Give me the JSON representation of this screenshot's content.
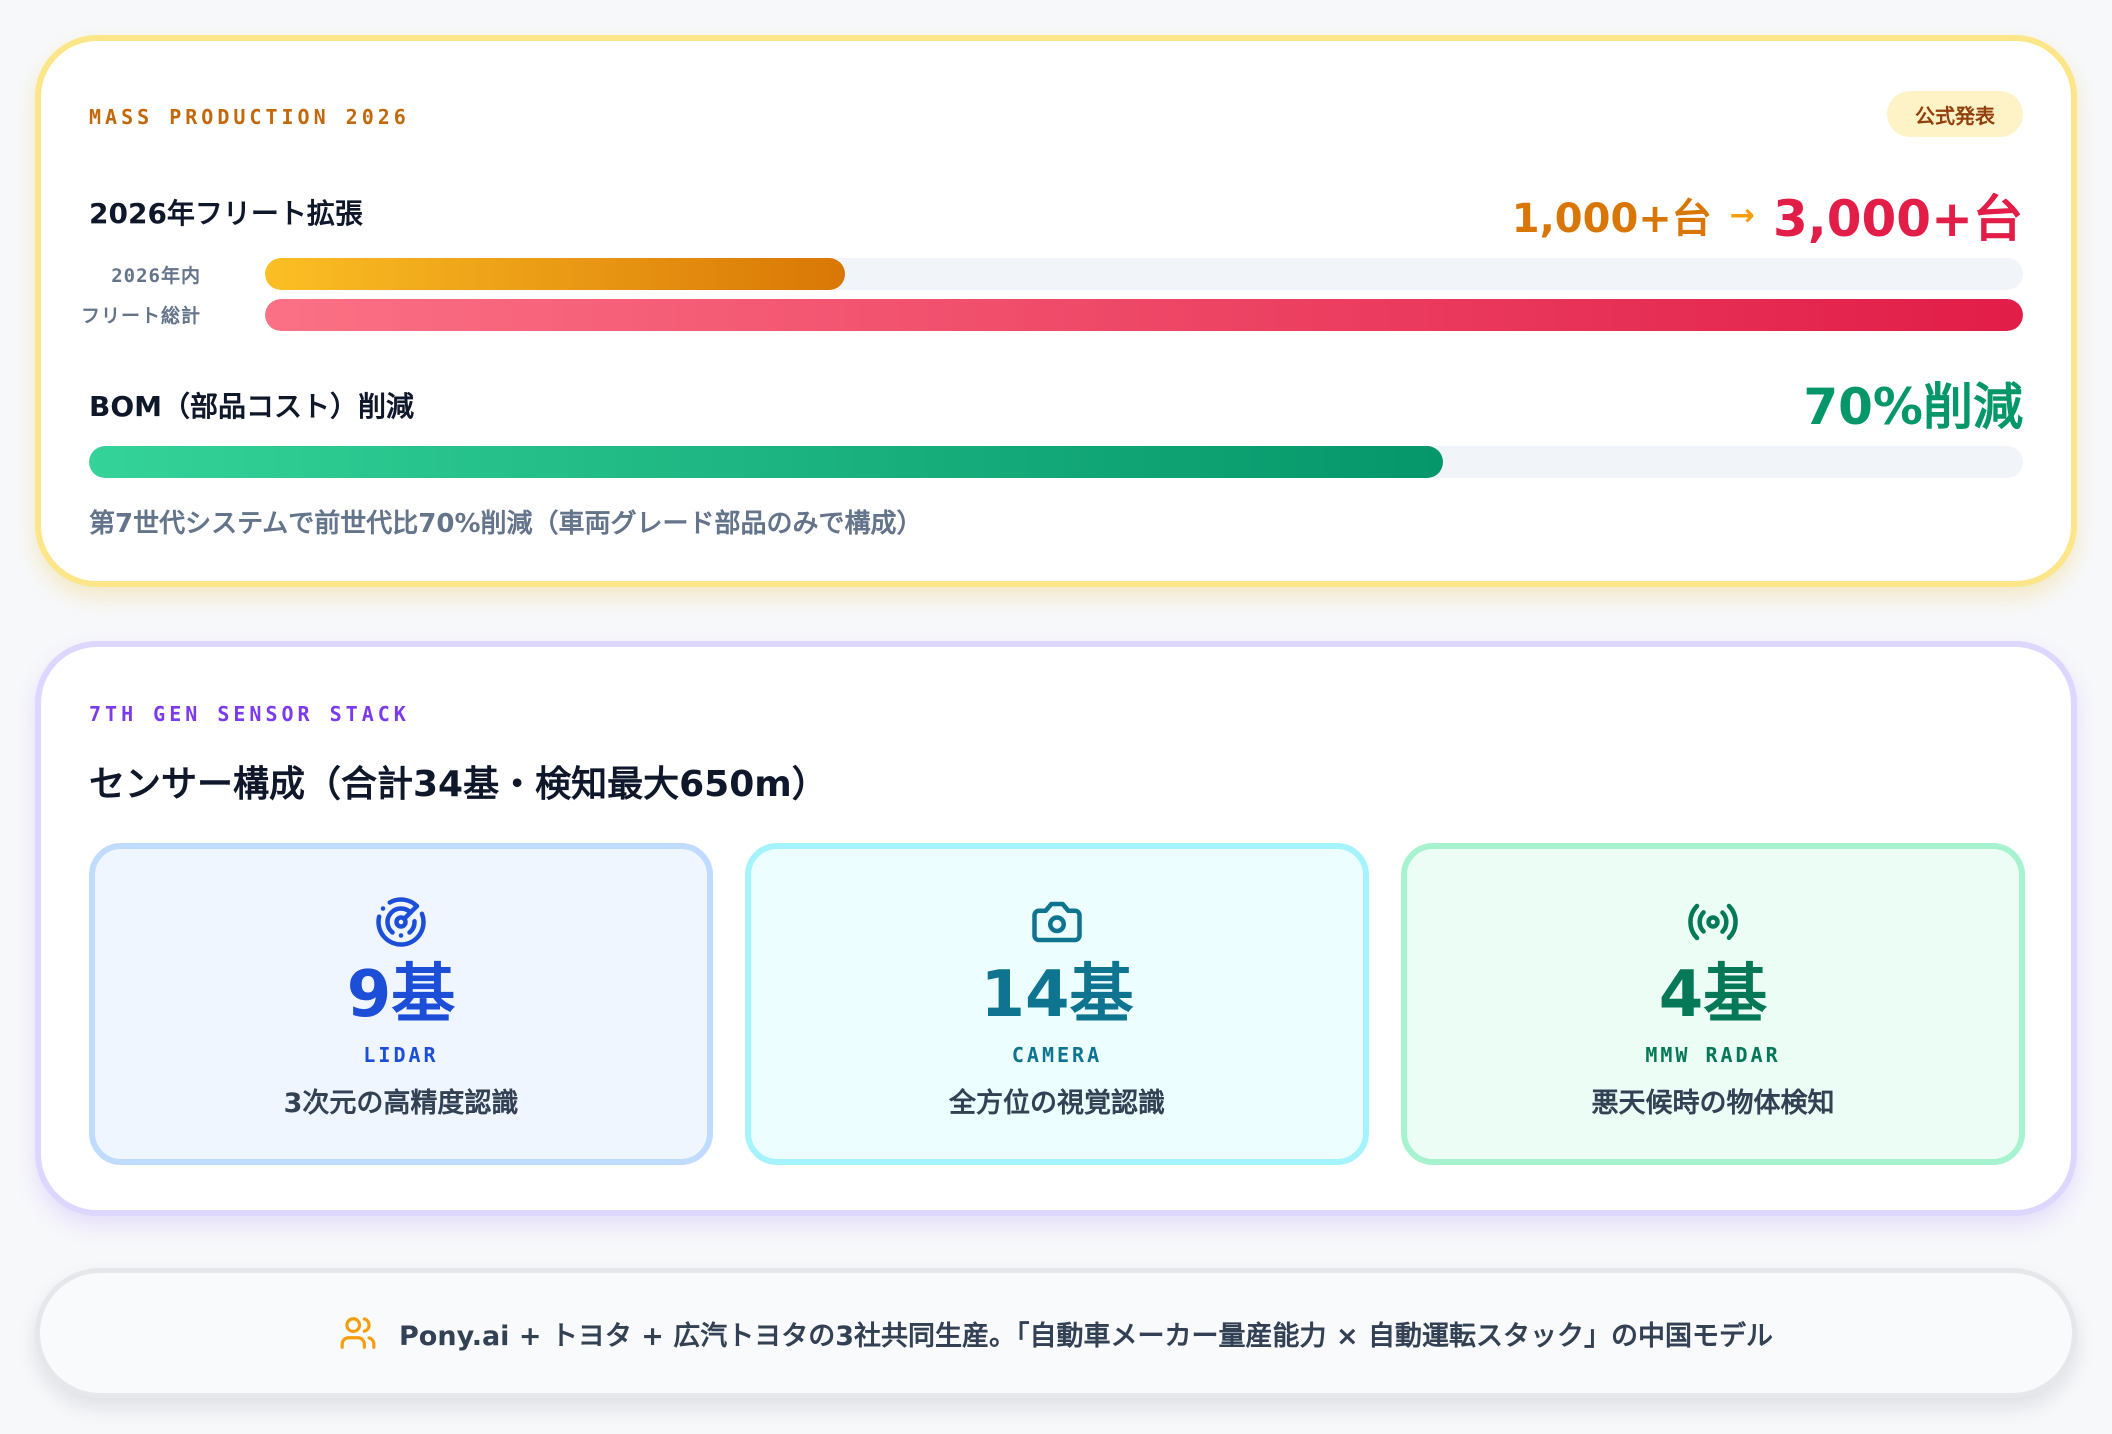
{
  "production": {
    "kicker": "MASS PRODUCTION 2026",
    "badge": "公式発表",
    "fleet": {
      "title": "2026年フリート拡張",
      "from": "1,000+台",
      "arrow": "→",
      "to": "3,000+台",
      "bars": [
        {
          "label": "2026年内",
          "progress": 0.33
        },
        {
          "label": "フリート総計",
          "progress": 1.0
        }
      ]
    },
    "bom": {
      "title": "BOM（部品コスト）削減",
      "value": "70%削減",
      "progress": 0.7,
      "note": "第7世代システムで前世代比70%削減（車両グレード部品のみで構成）"
    }
  },
  "sensors": {
    "kicker": "7TH GEN SENSOR STACK",
    "title": "センサー構成（合計34基・検知最大650m）",
    "items": [
      {
        "icon": "radar-icon",
        "count": "9基",
        "type": "LIDAR",
        "desc": "3次元の高精度認識",
        "color": "#1d4ed8"
      },
      {
        "icon": "camera-icon",
        "count": "14基",
        "type": "CAMERA",
        "desc": "全方位の視覚認識",
        "color": "#0e7490"
      },
      {
        "icon": "radio-waves-icon",
        "count": "4基",
        "type": "MMW RADAR",
        "desc": "悪天候時の物体検知",
        "color": "#047857"
      }
    ]
  },
  "footer": {
    "icon": "users-icon",
    "text": "Pony.ai + トヨタ + 広汽トヨタの3社共同生産。「自動車メーカー量産能力 × 自動運転スタック」の中国モデル"
  }
}
